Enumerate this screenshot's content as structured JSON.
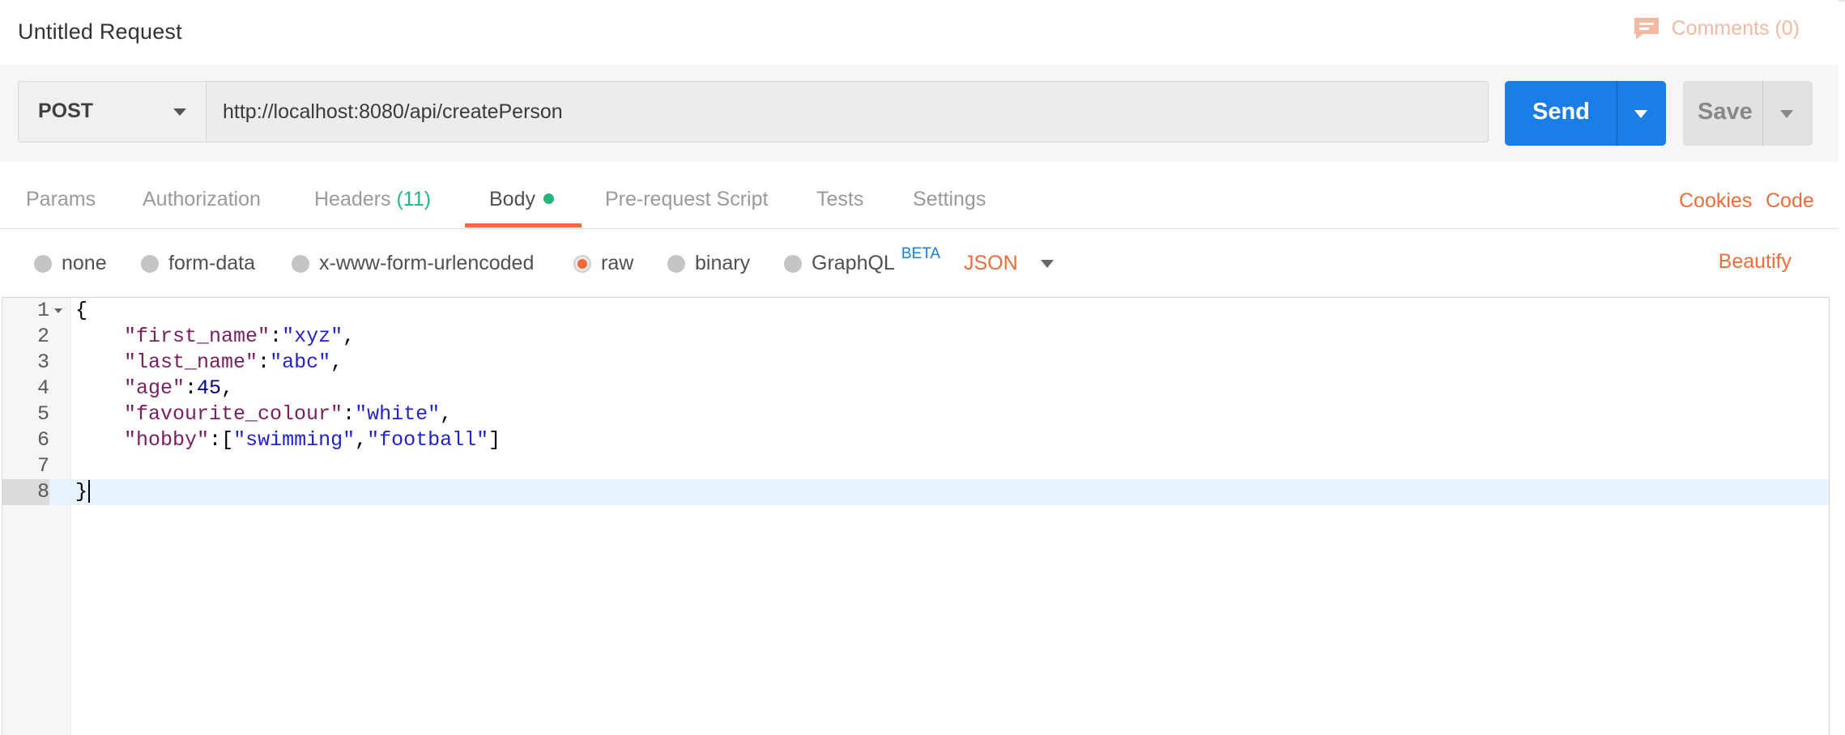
{
  "header": {
    "title": "Untitled Request",
    "comments_label": "Comments (0)",
    "comments_icon": "comment-icon"
  },
  "request": {
    "method": "POST",
    "url": "http://localhost:8080/api/createPerson",
    "send_label": "Send",
    "save_label": "Save"
  },
  "tabs": {
    "params": "Params",
    "authorization": "Authorization",
    "headers": "Headers",
    "headers_count": "(11)",
    "body": "Body",
    "prerequest": "Pre-request Script",
    "tests": "Tests",
    "settings": "Settings",
    "cookies": "Cookies",
    "code": "Code"
  },
  "body_types": {
    "none": "none",
    "form_data": "form-data",
    "urlencoded": "x-www-form-urlencoded",
    "raw": "raw",
    "binary": "binary",
    "graphql": "GraphQL",
    "beta": "BETA",
    "format": "JSON",
    "beautify": "Beautify",
    "selected": "raw"
  },
  "editor": {
    "line_numbers": [
      "1",
      "2",
      "3",
      "4",
      "5",
      "6",
      "7",
      "8"
    ],
    "active_line": 8,
    "lines": {
      "l1": {
        "open": "{"
      },
      "l2": {
        "key": "\"first_name\"",
        "colon": ":",
        "value": "\"xyz\"",
        "comma": ","
      },
      "l3": {
        "key": "\"last_name\"",
        "colon": ":",
        "value": "\"abc\"",
        "comma": ","
      },
      "l4": {
        "key": "\"age\"",
        "colon": ":",
        "value": "45",
        "comma": ","
      },
      "l5": {
        "key": "\"favourite_colour\"",
        "colon": ":",
        "value": "\"white\"",
        "comma": ","
      },
      "l6": {
        "key": "\"hobby\"",
        "colon": ":",
        "bracket_open": "[",
        "v1": "\"swimming\"",
        "sep": ",",
        "v2": "\"football\"",
        "bracket_close": "]"
      },
      "l8": {
        "close": "}"
      }
    }
  },
  "colors": {
    "accent_orange": "#f26b3a",
    "send_blue": "#1a7ee6",
    "status_green": "#26b47f"
  }
}
